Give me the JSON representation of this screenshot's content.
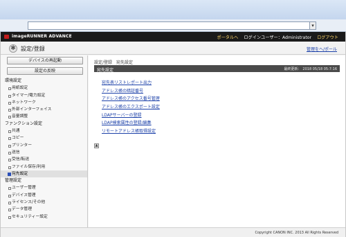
{
  "header": {
    "brand": "imageRUNNER ADVANCE",
    "portal_link": "ポータルへ",
    "login_user": "ログインユーザー：Administrator",
    "logout": "ログアウト"
  },
  "subheader": {
    "page_title": "設定/登録",
    "to_portal": "管理をヘ/ポール"
  },
  "sidebar": {
    "restart_button": "デバイスの再起動",
    "apply_button": "設定の反映",
    "sections": [
      {
        "title": "環境設定",
        "items": [
          "用紙設定",
          "タイマー/電力設定",
          "ネットワーク",
          "外部インターフェイス",
          "音量調整"
        ]
      },
      {
        "title": "ファンクション設定",
        "items": [
          "共通",
          "コピー",
          "プリンター",
          "送信",
          "受信/転送",
          "ファイル保存/利用"
        ]
      },
      {
        "title": "",
        "items": [
          "宛先設定"
        ]
      },
      {
        "title": "管理設定",
        "items": [
          "ユーザー管理",
          "デバイス管理",
          "ライセンス/その他",
          "データ管理",
          "セキュリティー設定"
        ]
      }
    ]
  },
  "content": {
    "breadcrumb": [
      "設定/登録",
      "宛先設定"
    ],
    "section_title": "宛先設定",
    "last_updated_label": "最終更新：",
    "last_updated_value": "2018 05/18 05:7:16",
    "links": [
      "宛先表リストレポート出力",
      "アドレス帳の暗証番号",
      "アドレス帳のアクセス番号管理",
      "アドレス帳のエクスポート設定",
      "LDAPサーバーの登録",
      "LDAP検索属性の登録/編集",
      "リモートアドレス帳取得設定"
    ]
  },
  "footer": {
    "copyright": "Copyright CANON INC. 2013 All Rights Reserved"
  },
  "icons": {
    "address_dropdown": "chevron-down-icon",
    "page_icon": "settings-icon",
    "scroll_top": "arrow-up-icon",
    "brand_mark": "canon-logo"
  },
  "colors": {
    "header_bg": "#1a1a1a",
    "link": "#1a3fa8",
    "section_bar": "#4a4a4a",
    "brand_accent": "#c21d1d"
  }
}
